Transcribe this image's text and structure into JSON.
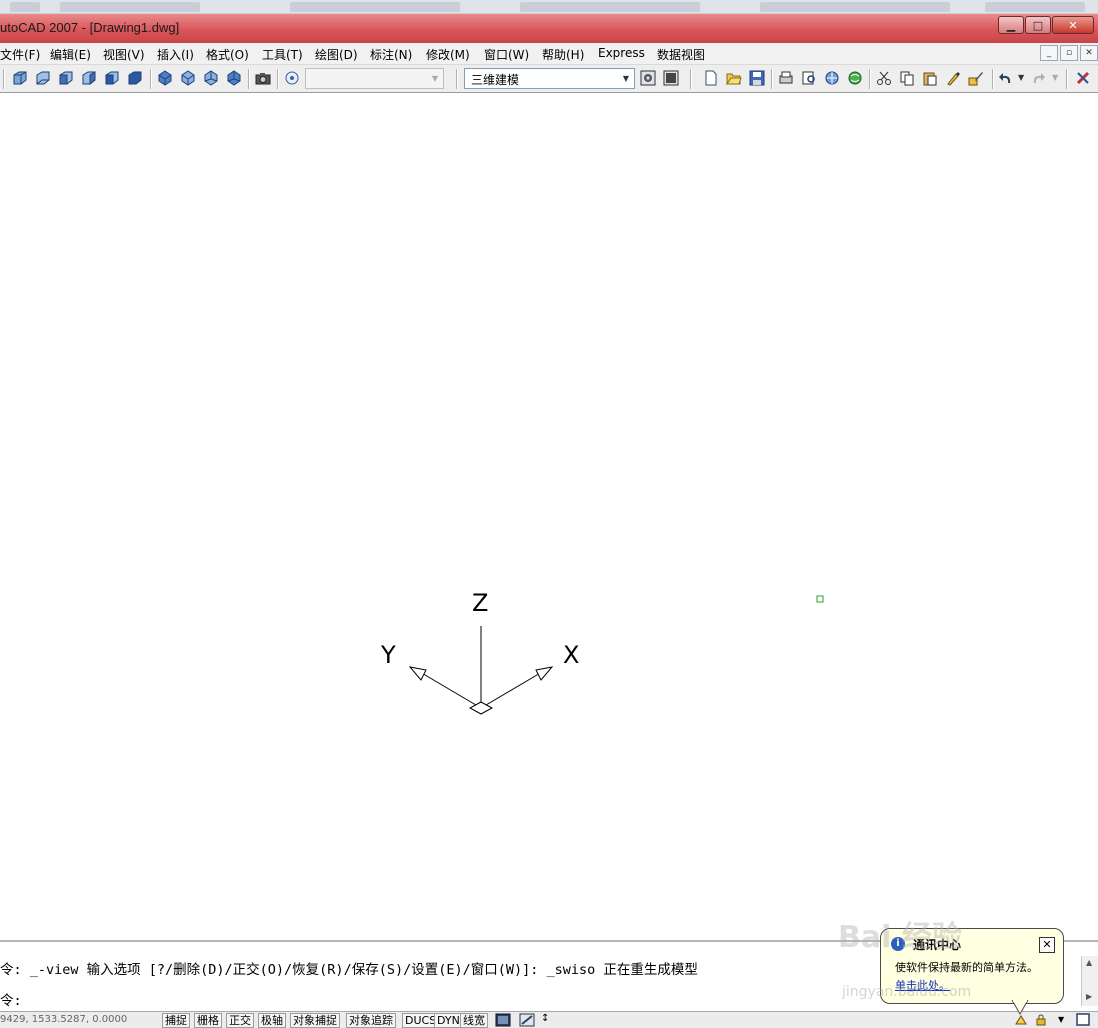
{
  "window": {
    "title": "utoCAD 2007 - [Drawing1.dwg]",
    "buttons": {
      "minimize": "▁",
      "maximize": "□",
      "close": "✕"
    }
  },
  "menubar": {
    "items": [
      "文件(F)",
      "编辑(E)",
      "视图(V)",
      "插入(I)",
      "格式(O)",
      "工具(T)",
      "绘图(D)",
      "标注(N)",
      "修改(M)",
      "窗口(W)",
      "帮助(H)",
      "Express",
      "数据视图"
    ],
    "mdi_buttons": [
      "_",
      "▫",
      "✕"
    ]
  },
  "toolbar": {
    "view_combo_value": "",
    "workspace_combo_value": "三维建模",
    "combo_arrow": "▼"
  },
  "canvas": {
    "ucs_labels": {
      "x": "X",
      "y": "Y",
      "z": "Z"
    }
  },
  "command": {
    "history_line": "令: _-view 输入选项 [?/删除(D)/正交(O)/恢复(R)/保存(S)/设置(E)/窗口(W)]: _swiso 正在重生成模型",
    "prompt_line": "令:"
  },
  "statusbar": {
    "coordinates": "9429, 1533.5287, 0.0000",
    "toggles": [
      "捕捉",
      "栅格",
      "正交",
      "极轴",
      "对象捕捉",
      "对象追踪",
      "DUCS",
      "DYN",
      "线宽"
    ]
  },
  "balloon": {
    "title": "通讯中心",
    "text": "使软件保持最新的简单方法。",
    "link": "单击此处。",
    "close": "✕",
    "icon": "i"
  },
  "watermark": {
    "main": "Bai 经验",
    "sub": "jingyan.baidu.com"
  }
}
